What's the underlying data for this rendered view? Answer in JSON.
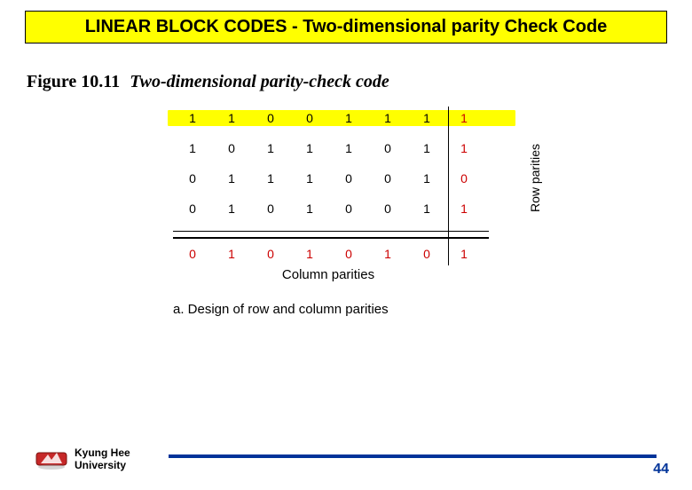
{
  "header": {
    "title": "LINEAR BLOCK CODES - Two-dimensional parity Check Code"
  },
  "figure": {
    "number": "Figure 10.11",
    "caption": "Two-dimensional parity-check code",
    "subcaption": "a. Design of row and column parities",
    "row_parities_label": "Row parities",
    "col_parities_label": "Column parities"
  },
  "chart_data": {
    "type": "table",
    "title": "Two-dimensional parity-check code",
    "rows": [
      [
        1,
        1,
        0,
        0,
        1,
        1,
        1
      ],
      [
        1,
        0,
        1,
        1,
        1,
        0,
        1
      ],
      [
        0,
        1,
        1,
        1,
        0,
        0,
        1
      ],
      [
        0,
        1,
        0,
        1,
        0,
        0,
        1
      ]
    ],
    "row_parities": [
      1,
      1,
      0,
      1
    ],
    "column_parities": [
      0,
      1,
      0,
      1,
      0,
      1,
      0
    ],
    "overall_parity": 1
  },
  "footer": {
    "university_line1": "Kyung Hee",
    "university_line2": "University",
    "page": "44"
  }
}
